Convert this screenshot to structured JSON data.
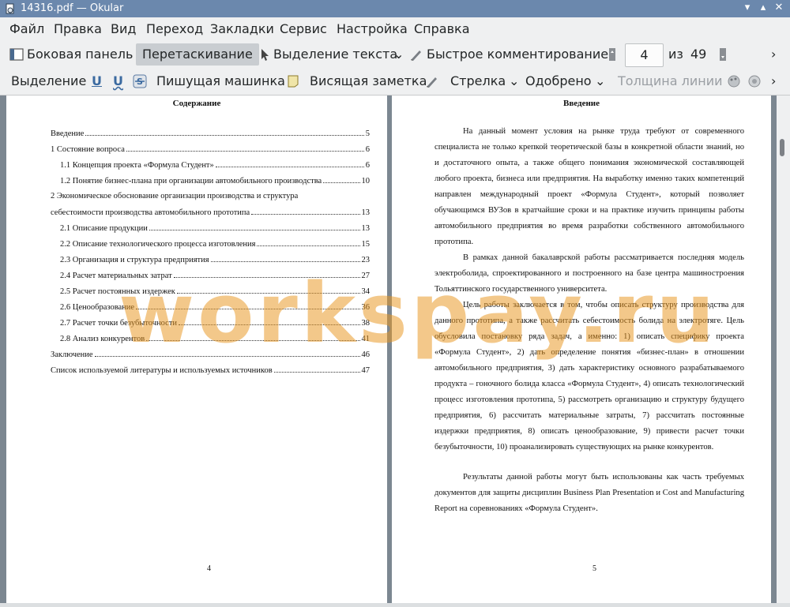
{
  "window": {
    "title": "14316.pdf — Okular"
  },
  "menu": [
    "Файл",
    "Правка",
    "Вид",
    "Переход",
    "Закладки",
    "Сервис",
    "Настройка",
    "Справка"
  ],
  "toolbar1": {
    "sidebar": "Боковая панель",
    "browse": "Перетаскивание",
    "text_select": "Выделение текста",
    "quick_annot": "Быстрое комментирование",
    "page_current": "4",
    "page_of": "из",
    "page_total": "49"
  },
  "toolbar2": {
    "highlight": "Выделение",
    "typewriter": "Пишущая машинка",
    "note": "Висящая заметка",
    "arrow": "Стрелка",
    "stamp": "Одобрено",
    "line_width": "Толщина линии"
  },
  "left_page": {
    "title": "Содержание",
    "toc": [
      {
        "label": "Введение",
        "page": "5"
      },
      {
        "label": "1 Состояние вопроса",
        "page": "6"
      },
      {
        "label": "1.1 Концепция проекта «Формула Студент»",
        "page": "6"
      },
      {
        "label": "1.2 Понятие бизнес-плана при организации автомобильного производства",
        "page": "10"
      },
      {
        "label": "2 Экономическое обоснование организации производства и структура",
        "page": ""
      },
      {
        "label": "себестоимости производства автомобильного прототипа",
        "page": "13"
      },
      {
        "label": "2.1 Описание продукции",
        "page": "13"
      },
      {
        "label": "2.2 Описание технологического процесса изготовления",
        "page": "15"
      },
      {
        "label": "2.3 Организация и структура предприятия",
        "page": "23"
      },
      {
        "label": "2.4 Расчет материальных затрат",
        "page": "27"
      },
      {
        "label": "2.5 Расчет постоянных издержек",
        "page": "34"
      },
      {
        "label": "2.6 Ценообразование",
        "page": "36"
      },
      {
        "label": "2.7 Расчет точки безубыточности",
        "page": "38"
      },
      {
        "label": "2.8 Анализ конкурентов",
        "page": "41"
      },
      {
        "label": "Заключение",
        "page": "46"
      },
      {
        "label": "Список используемой литературы и используемых источников",
        "page": "47"
      }
    ],
    "page_number": "4"
  },
  "right_page": {
    "title": "Введение",
    "paragraphs": [
      "На данный момент условия на рынке труда требуют от современного специалиста не только крепкой теоретической базы в конкретной области знаний, но и достаточного опыта, а также общего понимания экономической составляющей любого проекта, бизнеса или предприятия. На выработку именно таких компетенций направлен международный проект «Формула Студент», который позволяет обучающимся ВУЗов в кратчайшие сроки и на практике изучить принципы работы автомобильного предприятия во время разработки собственного автомобильного прототипа.",
      "В рамках данной бакалаврской работы рассматривается последняя модель электроболида, спроектированного и построенного на базе центра машиностроения Тольяттинского государственного университета.",
      "Цель работы заключается в том, чтобы описать структуру производства для данного прототипа, а также рассчитать себестоимость болида на электротяге. Цель обусловила постановку ряда задач, а именно: 1) описать специфику проекта «Формула Студент», 2) дать определение понятия «бизнес-план» в отношении автомобильного предприятия, 3) дать характеристику основного разрабатываемого продукта – гоночного болида класса «Формула Студент», 4) описать технологический процесс изготовления прототипа, 5) рассмотреть организацию и структуру будущего предприятия, 6) рассчитать материальные затраты, 7) рассчитать постоянные издержки предприятия, 8) описать ценообразование, 9) привести расчет точки безубыточности, 10) проанализировать существующих на рынке конкурентов.",
      "Результаты данной работы могут быть использованы как часть требуемых документов для защиты дисциплин Business Plan Presentation и Cost and Manufacturing Report на соревнованиях «Формула Студент»."
    ],
    "page_number": "5"
  },
  "watermark": "workspay.ru",
  "colors": {
    "titlebar": "#6b88ad",
    "watermark": "#e8961e",
    "chrome": "#eff0f1",
    "viewport": "#7c8791"
  }
}
